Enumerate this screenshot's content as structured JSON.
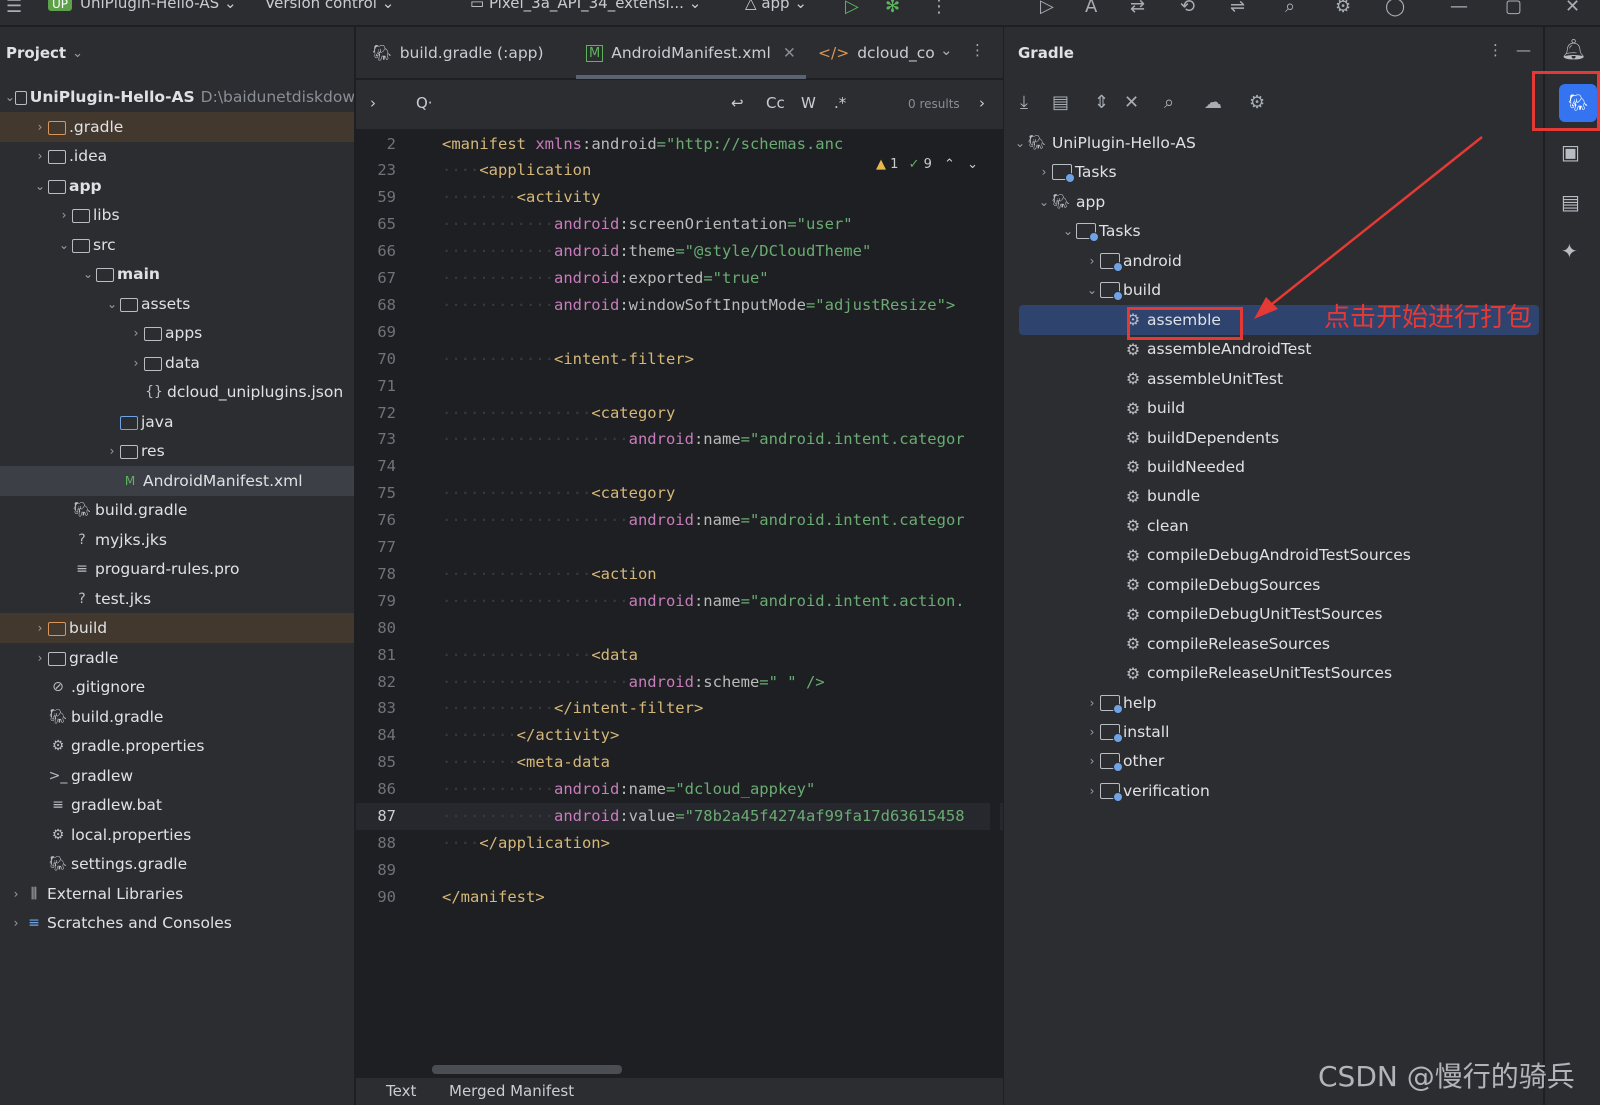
{
  "topbar": {
    "project_badge": "UP",
    "project_name": "UniPlugin-Hello-AS",
    "vcs": "Version control",
    "device": "Pixel_3a_API_34_extensi...",
    "run_config": "app"
  },
  "project_panel": {
    "title": "Project",
    "items": [
      {
        "label": "UniPlugin-Hello-AS",
        "path": "D:\\baidunetdiskdow"
      },
      {
        "label": ".gradle"
      },
      {
        "label": ".idea"
      },
      {
        "label": "app"
      },
      {
        "label": "libs"
      },
      {
        "label": "src"
      },
      {
        "label": "main"
      },
      {
        "label": "assets"
      },
      {
        "label": "apps"
      },
      {
        "label": "data"
      },
      {
        "label": "dcloud_uniplugins.json"
      },
      {
        "label": "java"
      },
      {
        "label": "res"
      },
      {
        "label": "AndroidManifest.xml"
      },
      {
        "label": "build.gradle"
      },
      {
        "label": "myjks.jks"
      },
      {
        "label": "proguard-rules.pro"
      },
      {
        "label": "test.jks"
      },
      {
        "label": "build"
      },
      {
        "label": "gradle"
      },
      {
        "label": ".gitignore"
      },
      {
        "label": "build.gradle"
      },
      {
        "label": "gradle.properties"
      },
      {
        "label": "gradlew"
      },
      {
        "label": "gradlew.bat"
      },
      {
        "label": "local.properties"
      },
      {
        "label": "settings.gradle"
      },
      {
        "label": "External Libraries"
      },
      {
        "label": "Scratches and Consoles"
      }
    ]
  },
  "editor": {
    "tabs": [
      {
        "label": "build.gradle (:app)"
      },
      {
        "label": "AndroidManifest.xml"
      },
      {
        "label": "dcloud_co"
      }
    ],
    "find": {
      "case": "Cc",
      "word": "W",
      "regex": ".*",
      "results": "0 results"
    },
    "inspections": {
      "warnings": "1",
      "ok": "9"
    },
    "lines": [
      {
        "n": "2",
        "indent": "",
        "tag": "<manifest ",
        "attr": "xmlns:android",
        "val": "=\"http://schemas.anc"
      },
      {
        "n": "23",
        "indent": "····",
        "tag": "<application",
        "attr": "",
        "val": ""
      },
      {
        "n": "59",
        "indent": "········",
        "tag": "<activity",
        "attr": "",
        "val": ""
      },
      {
        "n": "65",
        "indent": "············",
        "tag": "",
        "attr": "android:screenOrientation",
        "val": "=\"user\""
      },
      {
        "n": "66",
        "indent": "············",
        "tag": "",
        "attr": "android:theme",
        "val": "=\"@style/DCloudTheme\""
      },
      {
        "n": "67",
        "indent": "············",
        "tag": "",
        "attr": "android:exported",
        "val": "=\"true\""
      },
      {
        "n": "68",
        "indent": "············",
        "tag": "",
        "attr": "android:windowSoftInputMode",
        "val": "=\"adjustResize\">"
      },
      {
        "n": "69",
        "indent": "",
        "tag": "",
        "attr": "",
        "val": ""
      },
      {
        "n": "70",
        "indent": "············",
        "tag": "<intent-filter>",
        "attr": "",
        "val": ""
      },
      {
        "n": "71",
        "indent": "",
        "tag": "",
        "attr": "",
        "val": ""
      },
      {
        "n": "72",
        "indent": "················",
        "tag": "<category",
        "attr": "",
        "val": ""
      },
      {
        "n": "73",
        "indent": "····················",
        "tag": "",
        "attr": "android:name",
        "val": "=\"android.intent.categor"
      },
      {
        "n": "74",
        "indent": "",
        "tag": "",
        "attr": "",
        "val": ""
      },
      {
        "n": "75",
        "indent": "················",
        "tag": "<category",
        "attr": "",
        "val": ""
      },
      {
        "n": "76",
        "indent": "····················",
        "tag": "",
        "attr": "android:name",
        "val": "=\"android.intent.categor"
      },
      {
        "n": "77",
        "indent": "",
        "tag": "",
        "attr": "",
        "val": ""
      },
      {
        "n": "78",
        "indent": "················",
        "tag": "<action",
        "attr": "",
        "val": ""
      },
      {
        "n": "79",
        "indent": "····················",
        "tag": "",
        "attr": "android:name",
        "val": "=\"android.intent.action."
      },
      {
        "n": "80",
        "indent": "",
        "tag": "",
        "attr": "",
        "val": ""
      },
      {
        "n": "81",
        "indent": "················",
        "tag": "<data",
        "attr": "",
        "val": ""
      },
      {
        "n": "82",
        "indent": "····················",
        "tag": "",
        "attr": "android:scheme",
        "val": "=\" \" />"
      },
      {
        "n": "83",
        "indent": "············",
        "tag": "</intent-filter>",
        "attr": "",
        "val": ""
      },
      {
        "n": "84",
        "indent": "········",
        "tag": "</activity>",
        "attr": "",
        "val": ""
      },
      {
        "n": "85",
        "indent": "········",
        "tag": "<meta-data",
        "attr": "",
        "val": ""
      },
      {
        "n": "86",
        "indent": "············",
        "tag": "",
        "attr": "android:name",
        "val": "=\"dcloud_appkey\""
      },
      {
        "n": "87",
        "indent": "············",
        "tag": "",
        "attr": "android:value",
        "val": "=\"78b2a45f4274af99fa17d63615458"
      },
      {
        "n": "88",
        "indent": "····",
        "tag": "</application>",
        "attr": "",
        "val": ""
      },
      {
        "n": "89",
        "indent": "",
        "tag": "",
        "attr": "",
        "val": ""
      },
      {
        "n": "90",
        "indent": "",
        "tag": "</manifest>",
        "attr": "",
        "val": ""
      }
    ],
    "bottom_tabs": [
      "Text",
      "Merged Manifest"
    ]
  },
  "gradle_panel": {
    "title": "Gradle",
    "items": [
      {
        "label": "UniPlugin-Hello-AS"
      },
      {
        "label": "Tasks"
      },
      {
        "label": "app"
      },
      {
        "label": "Tasks"
      },
      {
        "label": "android"
      },
      {
        "label": "build"
      },
      {
        "label": "assemble"
      },
      {
        "label": "assembleAndroidTest"
      },
      {
        "label": "assembleUnitTest"
      },
      {
        "label": "build"
      },
      {
        "label": "buildDependents"
      },
      {
        "label": "buildNeeded"
      },
      {
        "label": "bundle"
      },
      {
        "label": "clean"
      },
      {
        "label": "compileDebugAndroidTestSources"
      },
      {
        "label": "compileDebugSources"
      },
      {
        "label": "compileDebugUnitTestSources"
      },
      {
        "label": "compileReleaseSources"
      },
      {
        "label": "compileReleaseUnitTestSources"
      },
      {
        "label": "help"
      },
      {
        "label": "install"
      },
      {
        "label": "other"
      },
      {
        "label": "verification"
      }
    ],
    "annotation": "点击开始进行打包"
  },
  "watermark": "CSDN @慢行的骑兵",
  "colors": {
    "accent": "#3574f0",
    "annotation": "#e53935",
    "selection": "#2e436e"
  }
}
